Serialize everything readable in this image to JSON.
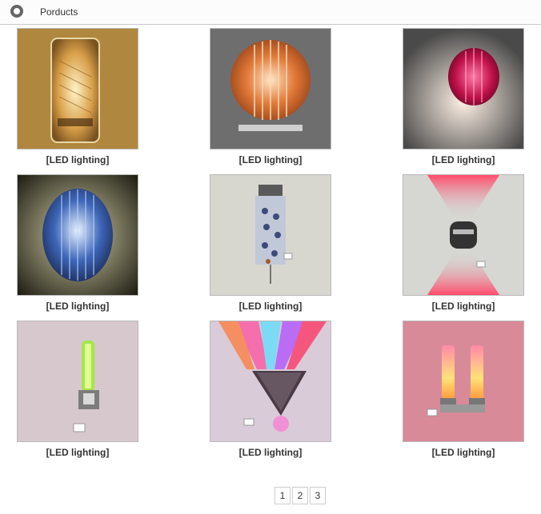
{
  "header": {
    "icon": "circle-ring-icon",
    "title": "Porducts"
  },
  "products": [
    {
      "caption": "[LED lighting]",
      "image": "cylinder-tree-lamp"
    },
    {
      "caption": "[LED lighting]",
      "image": "orange-shell-lamp"
    },
    {
      "caption": "[LED lighting]",
      "image": "magenta-shell-lamp"
    },
    {
      "caption": "[LED lighting]",
      "image": "blue-shell-lamp"
    },
    {
      "caption": "[LED lighting]",
      "image": "crystal-tube-lamp"
    },
    {
      "caption": "[LED lighting]",
      "image": "red-updown-lamp"
    },
    {
      "caption": "[LED lighting]",
      "image": "green-tube-lamp"
    },
    {
      "caption": "[LED lighting]",
      "image": "triangle-rgb-lamp"
    },
    {
      "caption": "[LED lighting]",
      "image": "twin-tube-lamp"
    }
  ],
  "pagination": {
    "pages": [
      "1",
      "2",
      "3"
    ]
  },
  "colors": {
    "border": "#b9b9b9",
    "text": "#333333"
  }
}
